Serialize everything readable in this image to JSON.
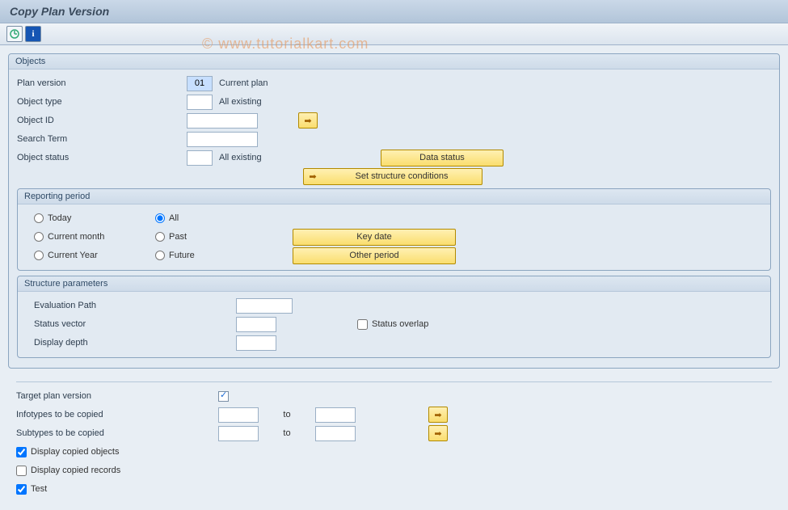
{
  "title": "Copy Plan Version",
  "watermark": "© www.tutorialkart.com",
  "objects": {
    "header": "Objects",
    "plan_version": {
      "label": "Plan version",
      "value": "01",
      "desc": "Current plan"
    },
    "object_type": {
      "label": "Object type",
      "value": "",
      "desc": "All existing"
    },
    "object_id": {
      "label": "Object ID",
      "value": ""
    },
    "search_term": {
      "label": "Search Term",
      "value": ""
    },
    "object_status": {
      "label": "Object status",
      "value": "",
      "desc": "All existing"
    },
    "btn_data_status": "Data status",
    "btn_set_structure": "Set structure conditions"
  },
  "reporting": {
    "header": "Reporting period",
    "options_left": [
      "Today",
      "Current month",
      "Current Year"
    ],
    "options_right": [
      "All",
      "Past",
      "Future"
    ],
    "selected": "All",
    "btn_keydate": "Key date",
    "btn_other": "Other period"
  },
  "structure": {
    "header": "Structure parameters",
    "eval_path": {
      "label": "Evaluation Path"
    },
    "status_vector": {
      "label": "Status vector"
    },
    "display_depth": {
      "label": "Display depth"
    },
    "status_overlap": {
      "label": "Status overlap",
      "checked": false
    }
  },
  "bottom": {
    "target_plan": {
      "label": "Target plan version"
    },
    "infotypes": {
      "label": "Infotypes to be copied",
      "to": "to"
    },
    "subtypes": {
      "label": "Subtypes to be copied",
      "to": "to"
    },
    "display_objects": {
      "label": "Display copied objects",
      "checked": true
    },
    "display_records": {
      "label": "Display copied records",
      "checked": false
    },
    "test": {
      "label": "Test",
      "checked": true
    }
  }
}
